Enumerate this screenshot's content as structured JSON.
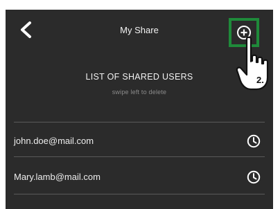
{
  "header": {
    "title": "My Share",
    "back_icon": "back-chevron-icon",
    "add_icon": "plus-circle-icon",
    "highlight_color": "#1f8a3a"
  },
  "callout": {
    "step_label": "2."
  },
  "section": {
    "title": "LIST OF SHARED USERS",
    "hint": "swipe left to delete"
  },
  "users": [
    {
      "email": "john.doe@mail.com",
      "action_icon": "clock-icon"
    },
    {
      "email": "Mary.lamb@mail.com",
      "action_icon": "clock-icon"
    }
  ]
}
